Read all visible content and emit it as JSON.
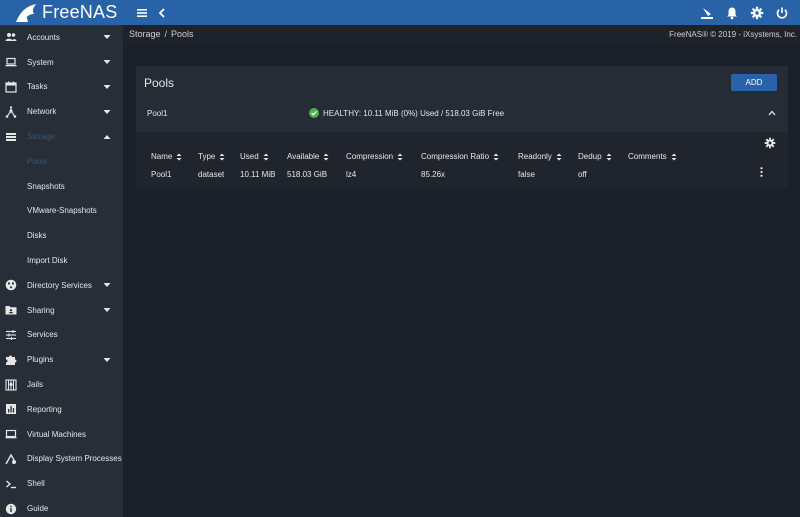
{
  "app": {
    "brand": "FreeNAS",
    "copyright": "FreeNAS® © 2019 - iXsystems, Inc."
  },
  "colors": {
    "topbar": "#2863a8",
    "sidebar": "#282e37",
    "content": "#1c2129",
    "accent": "#2863a8",
    "healthy": "#4caf50",
    "active_nav": "#3a5476"
  },
  "topbar": {
    "icons": [
      "menu-icon",
      "chevron-left-icon",
      "ix-logo-icon",
      "bell-icon",
      "gear-icon",
      "power-icon"
    ]
  },
  "breadcrumb": {
    "first": "Storage",
    "separator": "/",
    "second": "Pools"
  },
  "sidebar": {
    "items": [
      {
        "label": "Accounts",
        "icon": "people-icon",
        "caret": "down"
      },
      {
        "label": "System",
        "icon": "laptop-icon",
        "caret": "down"
      },
      {
        "label": "Tasks",
        "icon": "calendar-icon",
        "caret": "down"
      },
      {
        "label": "Network",
        "icon": "network-icon",
        "caret": "down"
      },
      {
        "label": "Storage",
        "icon": "storage-icon",
        "caret": "up"
      },
      {
        "label": "Pools"
      },
      {
        "label": "Snapshots"
      },
      {
        "label": "VMware-Snapshots"
      },
      {
        "label": "Disks"
      },
      {
        "label": "Import Disk"
      },
      {
        "label": "Directory Services",
        "icon": "directory-icon",
        "caret": "down"
      },
      {
        "label": "Sharing",
        "icon": "folder-share-icon",
        "caret": "down"
      },
      {
        "label": "Services",
        "icon": "sliders-icon"
      },
      {
        "label": "Plugins",
        "icon": "puzzle-icon",
        "caret": "down"
      },
      {
        "label": "Jails",
        "icon": "jail-icon"
      },
      {
        "label": "Reporting",
        "icon": "chart-icon"
      },
      {
        "label": "Virtual Machines",
        "icon": "monitor-icon"
      },
      {
        "label": "Display System Processes",
        "icon": "processes-icon"
      },
      {
        "label": "Shell",
        "icon": "terminal-icon"
      },
      {
        "label": "Guide",
        "icon": "info-icon"
      }
    ]
  },
  "panel": {
    "title": "Pools",
    "add_label": "ADD",
    "pool": {
      "name": "Pool1",
      "status": "HEALTHY: 10.11 MiB (0%) Used / 518.03 GiB Free"
    },
    "table": {
      "headers": [
        "Name",
        "Type",
        "Used",
        "Available",
        "Compression",
        "Compression Ratio",
        "Readonly",
        "Dedup",
        "Comments"
      ],
      "rows": [
        [
          "Pool1",
          "dataset",
          "10.11 MiB",
          "518.03 GiB",
          "lz4",
          "85.26x",
          "false",
          "off",
          ""
        ]
      ]
    }
  }
}
